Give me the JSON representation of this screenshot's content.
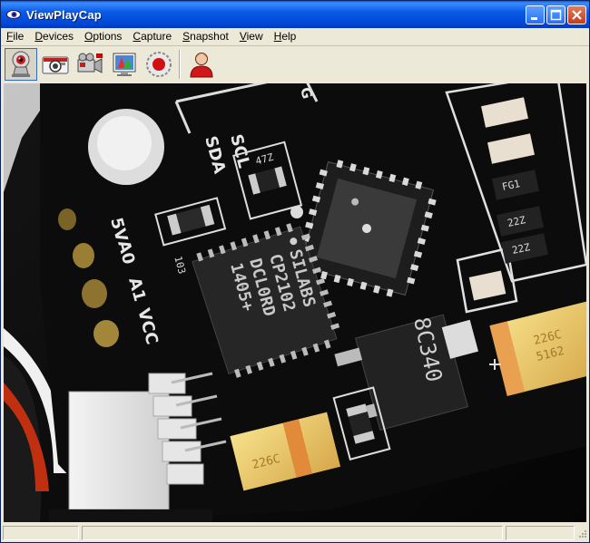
{
  "window": {
    "title": "ViewPlayCap"
  },
  "menu": [
    {
      "first": "F",
      "rest": "ile"
    },
    {
      "first": "D",
      "rest": "evices"
    },
    {
      "first": "O",
      "rest": "ptions"
    },
    {
      "first": "C",
      "rest": "apture"
    },
    {
      "first": "S",
      "rest": "napshot"
    },
    {
      "first": "V",
      "rest": "iew"
    },
    {
      "first": "H",
      "rest": "elp"
    }
  ],
  "toolbar": {
    "icons": [
      "webcam-preview-icon",
      "snapshot-camera-icon",
      "video-camera-icon",
      "video-settings-icon",
      "record-icon",
      "user-icon"
    ]
  },
  "video": {
    "board_labels": {
      "scl": "SCL",
      "sda": "SDA",
      "five_v": "5V",
      "a0": "A0",
      "a1": "A1",
      "vcc": "VCC",
      "g": "G",
      "r47": "47Z",
      "r103": "103",
      "fg": "FG1",
      "r22a": "22Z",
      "r22b": "22Z"
    },
    "chip_lines": [
      "SILABS",
      "CP2102",
      "DCL0RD",
      "1405+"
    ],
    "regulator_text": "8C340",
    "cap_left": "226C",
    "cap_right_lines": [
      "226C",
      "5162"
    ]
  },
  "status": {
    "pane1": "",
    "pane2": ""
  }
}
